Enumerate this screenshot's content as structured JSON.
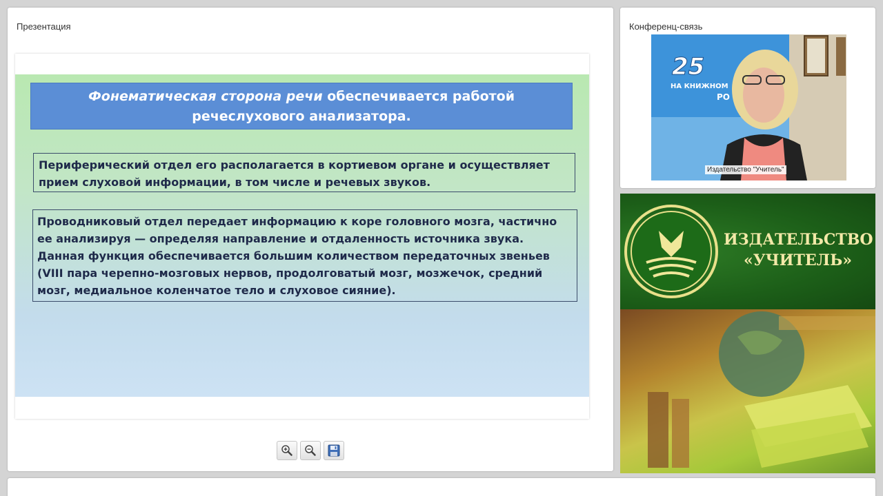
{
  "presentation": {
    "title": "Презентация",
    "slide": {
      "heading_italic": "Фонематическая сторона речи",
      "heading_rest": " обеспечивается работой речеслухового анализатора.",
      "box1": "Периферический отдел его располагается в кортиевом органе и осуществляет прием слуховой информации, в том числе и речевых звуков.",
      "box2": "Проводниковый отдел передает информацию к коре головного мозга, частично ее анализируя — определяя направление и отдаленность источника звука. Данная функция обеспечивается большим количеством передаточных звеньев (VIII пара черепно-мозговых нервов, продолговатый мозг, мозжечок, средний мозг, медиальное коленчатое тело и слуховое сияние)."
    },
    "toolbar": {
      "zoom_in_icon": "zoom-in-icon",
      "zoom_out_icon": "zoom-out-icon",
      "save_icon": "floppy-disk-icon"
    }
  },
  "conference": {
    "title": "Конференц-связь",
    "video_caption": "Издательство \"Учитель\"",
    "banner_text": "25 ЛЕТ НА КНИЖНОМ РО"
  },
  "publisher": {
    "name": "ИЗДАТЕЛЬСТВО «УЧИТЕЛЬ»"
  },
  "colors": {
    "heading_bg": "#5b8ed6",
    "publisher_green": "#1c5e18",
    "publisher_text": "#f3e9a8"
  }
}
